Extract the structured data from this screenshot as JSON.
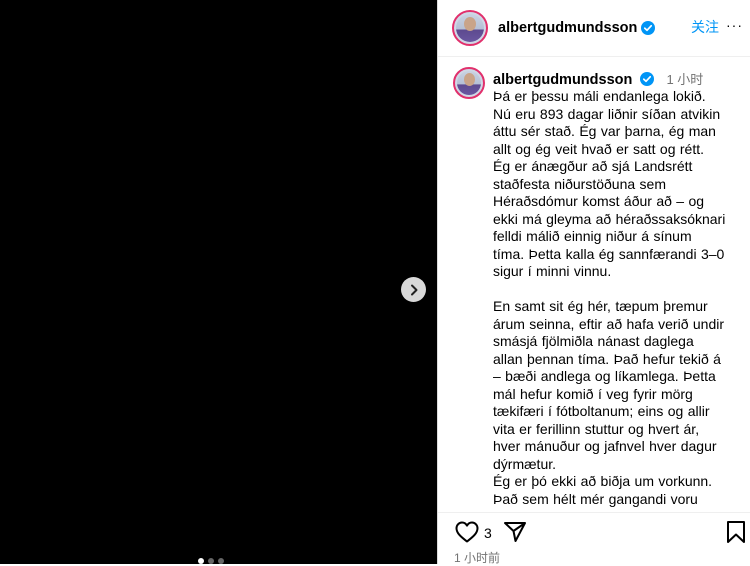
{
  "post": {
    "username": "albertgudmundsson",
    "follow_label": "关注",
    "more_label": "···",
    "caption_time": "1 小时",
    "caption": "Þá er þessu máli endanlega lokið.\nNú eru 893 dagar liðnir síðan atvikin\náttu sér stað. Ég var þarna, ég man\nallt og ég veit hvað er satt og rétt.\nÉg er ánægður að sjá Landsrétt\nstaðfesta niðurstöðuna sem\nHéraðsdómur komst áður að – og\nekki má gleyma að héraðssaksóknari\nfelldi málið einnig niður á sínum\ntíma. Þetta kalla ég sannfærandi 3–0\nsigur í minni vinnu.\n\nEn samt sit ég hér, tæpum þremur\nárum seinna, eftir að hafa verið undir\nsmásjá fjölmiðla nánast daglega\nallan þennan tíma. Það hefur tekið á\n– bæði andlega og líkamlega. Þetta\nmál hefur komið í veg fyrir mörg\ntækifæri í fótboltanum; eins og allir\nvita er ferillinn stuttur og hvert ár,\nhver mánuður og jafnvel hver dagur\ndýrmætur.\nÉg er þó ekki að biðja um vorkunn.\nÞað sem hélt mér gangandi voru",
    "likes": "3",
    "posted_time": "1 小时前",
    "carousel": {
      "count": 3,
      "active": 0
    }
  },
  "icons": {
    "next": "chevron-right-icon",
    "verified": "verified-badge-icon",
    "like": "heart-icon",
    "share": "paper-plane-icon",
    "save": "bookmark-icon"
  },
  "colors": {
    "accent": "#0095f6",
    "media_bg": "#000000",
    "muted": "#737373"
  }
}
